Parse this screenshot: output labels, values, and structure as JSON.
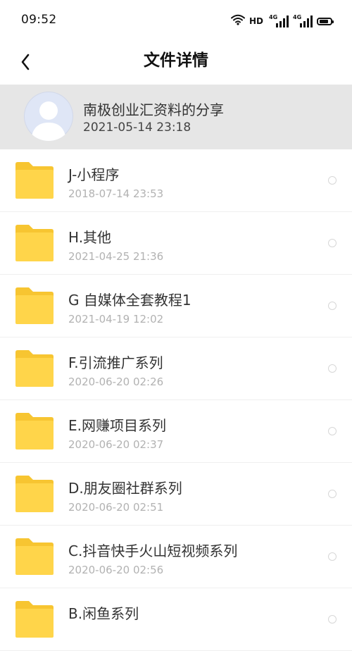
{
  "status_bar": {
    "time": "09:52",
    "hd_label": "HD",
    "network_a": "4G",
    "network_b": "4G",
    "icons": [
      "wifi-icon",
      "signal-icon",
      "signal-icon",
      "battery-icon"
    ]
  },
  "nav": {
    "title": "文件详情",
    "back_icon": "chevron-left-icon"
  },
  "share": {
    "title": "南极创业汇资料的分享",
    "time": "2021-05-14  23:18",
    "avatar_icon": "default-avatar-icon"
  },
  "colors": {
    "folder": "#FFD54A",
    "folder_tab": "#F7C531",
    "header_bg": "#E6E6E6",
    "secondary_text": "#B2B2B2"
  },
  "files": [
    {
      "name": "J-小程序",
      "time": "2018-07-14  23:53"
    },
    {
      "name": "H.其他",
      "time": "2021-04-25  21:36"
    },
    {
      "name": "G 自媒体全套教程1",
      "time": "2021-04-19  12:02"
    },
    {
      "name": "F.引流推广系列",
      "time": "2020-06-20  02:26"
    },
    {
      "name": "E.网赚项目系列",
      "time": "2020-06-20  02:37"
    },
    {
      "name": "D.朋友圈社群系列",
      "time": "2020-06-20  02:51"
    },
    {
      "name": "C.抖音快手火山短视频系列",
      "time": "2020-06-20  02:56"
    },
    {
      "name": "B.闲鱼系列",
      "time": ""
    }
  ]
}
